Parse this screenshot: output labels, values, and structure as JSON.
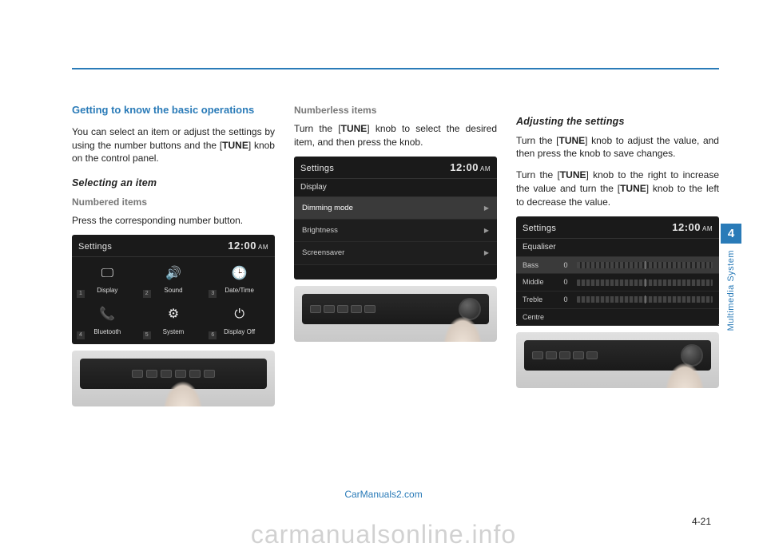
{
  "header_rule": true,
  "col1": {
    "title": "Getting to know the basic operations",
    "intro": "You can select an item or adjust the settings by using the number buttons and the [",
    "intro_bold": "TUNE",
    "intro_after": "] knob on the control panel.",
    "sub1": "Selecting an item",
    "sub2": "Numbered items",
    "para2": "Press the corresponding number button.",
    "screen": {
      "title": "Settings",
      "time": "12:00",
      "ampm": "AM",
      "cells": [
        {
          "num": "1",
          "icon": "🖵",
          "label": "Display"
        },
        {
          "num": "2",
          "icon": "🔊",
          "label": "Sound"
        },
        {
          "num": "3",
          "icon": "🕒",
          "label": "Date/Time"
        },
        {
          "num": "4",
          "icon": "📞",
          "label": "Bluetooth"
        },
        {
          "num": "5",
          "icon": "⚙",
          "label": "System"
        },
        {
          "num": "6",
          "icon": "⏻",
          "label": "Display Off"
        }
      ]
    }
  },
  "col2": {
    "sub1": "Numberless items",
    "para1a": "Turn the [",
    "para1_bold": "TUNE",
    "para1b": "] knob to select the desired item, and then press the knob.",
    "screen": {
      "title": "Settings",
      "time": "12:00",
      "ampm": "AM",
      "subheader": "Display",
      "items": [
        {
          "label": "Dimming mode",
          "highlight": true
        },
        {
          "label": "Brightness",
          "highlight": false
        },
        {
          "label": "Screensaver",
          "highlight": false
        }
      ]
    }
  },
  "col3": {
    "sub1": "Adjusting the settings",
    "para1a": "Turn the [",
    "para1_bold": "TUNE",
    "para1b": "] knob to adjust the value, and then press the knob to save changes.",
    "para2a": "Turn the [",
    "para2_bold1": "TUNE",
    "para2b": "] knob to the right to increase the value and turn the [",
    "para2_bold2": "TUNE",
    "para2c": "] knob to the left to decrease the value.",
    "screen": {
      "title": "Settings",
      "time": "12:00",
      "ampm": "AM",
      "subheader": "Equaliser",
      "rows": [
        {
          "label": "Bass",
          "val": "0",
          "highlight": true
        },
        {
          "label": "Middle",
          "val": "0",
          "highlight": false
        },
        {
          "label": "Treble",
          "val": "0",
          "highlight": false
        },
        {
          "label": "Centre",
          "val": "",
          "highlight": false
        }
      ]
    }
  },
  "side": {
    "num": "4",
    "label": "Multimedia System"
  },
  "page_num": "4-21",
  "watermark_center": "CarManuals2.com",
  "watermark_big": "carmanualsonline.info"
}
